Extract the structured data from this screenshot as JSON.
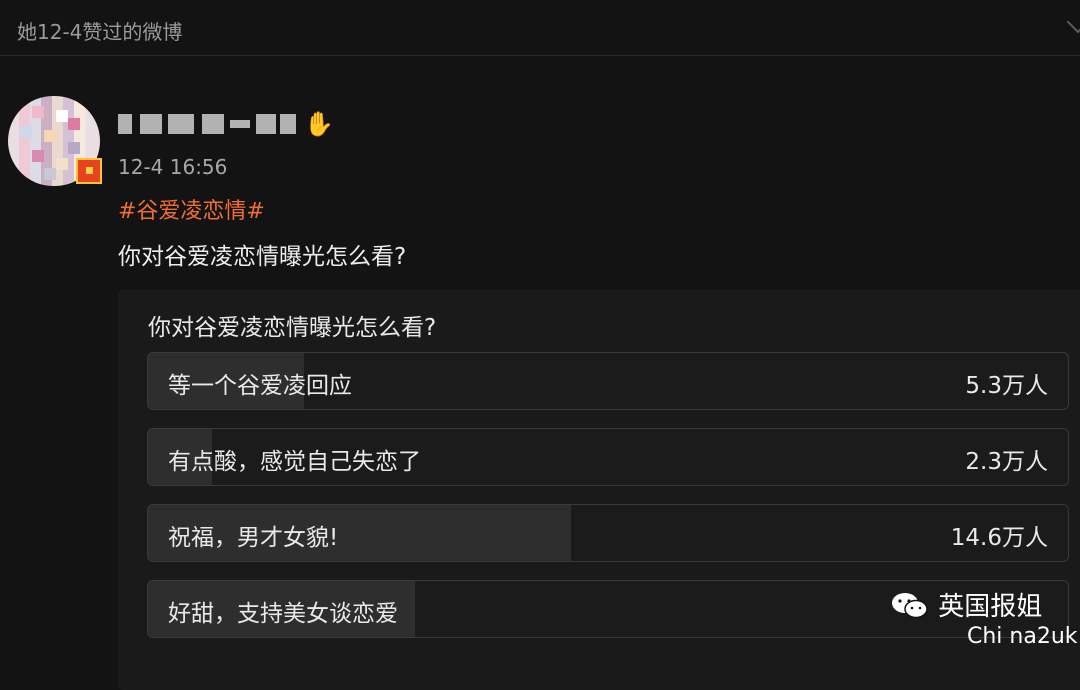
{
  "header": {
    "title": "她12-4赞过的微博"
  },
  "post": {
    "time": "12-4 16:56",
    "topic": "#谷爱凌恋情#",
    "text": "你对谷爱凌恋情曝光怎么看?"
  },
  "poll": {
    "question": "你对谷爱凌恋情曝光怎么看?",
    "options": [
      {
        "label": "等一个谷爱凌回应",
        "count": "5.3万人",
        "share": 0.17
      },
      {
        "label": "有点酸，感觉自己失恋了",
        "count": "2.3万人",
        "share": 0.07
      },
      {
        "label": "祝福，男才女貌!",
        "count": "14.6万人",
        "share": 0.46
      },
      {
        "label": "好甜，支持美女谈恋爱",
        "count": "",
        "share": 0.29
      }
    ]
  },
  "watermark": {
    "line1": "英国报姐",
    "line2": "Chi na2uk"
  },
  "colors": {
    "topic": "#f06d33",
    "background": "#131313"
  }
}
